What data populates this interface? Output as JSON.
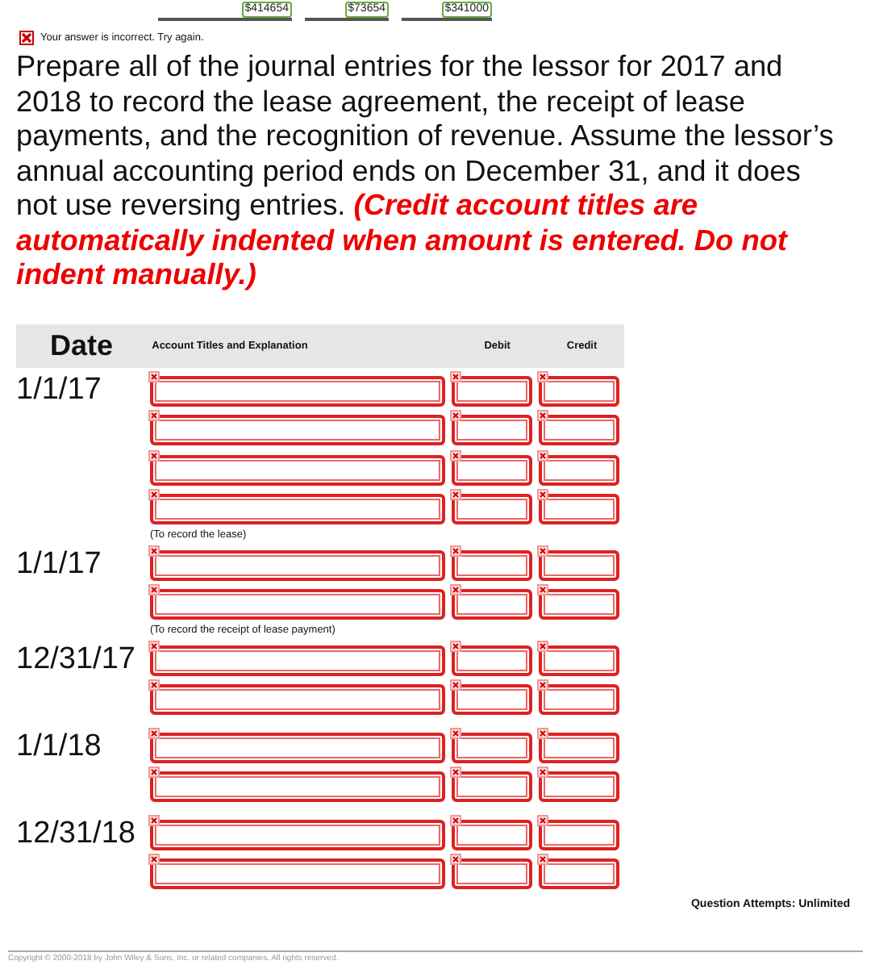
{
  "previous_answers": [
    "$414654",
    "$73654",
    "$341000"
  ],
  "feedback": {
    "incorrect": true,
    "message": "Your answer is incorrect.  Try again."
  },
  "instructions": "Prepare all of the journal entries for the lessor for 2017 and 2018 to record the lease agreement, the receipt of lease payments, and the recognition of revenue. Assume the lessor’s annual accounting period ends on December 31, and it does not use reversing entries.",
  "instructions_note": "(Credit account titles are automatically indented when amount is entered. Do not indent manually.)",
  "table": {
    "columns": [
      "Date",
      "Account Titles and Explanation",
      "Debit",
      "Credit"
    ],
    "entries": [
      {
        "date": "1/1/17",
        "lines": [
          {
            "incorrect": true
          },
          {
            "incorrect": true
          },
          {
            "incorrect": true
          },
          {
            "incorrect": true
          }
        ],
        "note": "(To record the lease)"
      },
      {
        "date": "1/1/17",
        "lines": [
          {
            "incorrect": true
          },
          {
            "incorrect": true
          }
        ],
        "note": "(To record the receipt of lease payment)"
      },
      {
        "date": "12/31/17",
        "lines": [
          {
            "incorrect": true
          },
          {
            "incorrect": true
          }
        ]
      },
      {
        "date": "1/1/18",
        "lines": [
          {
            "incorrect": true
          },
          {
            "incorrect": true
          }
        ]
      },
      {
        "date": "12/31/18",
        "lines": [
          {
            "incorrect": true
          },
          {
            "incorrect": true
          }
        ]
      }
    ]
  },
  "attempts": "Question Attempts: Unlimited",
  "copyright": "Copyright © 2000-2018 by John Wiley & Sons, Inc. or related companies. All rights reserved."
}
